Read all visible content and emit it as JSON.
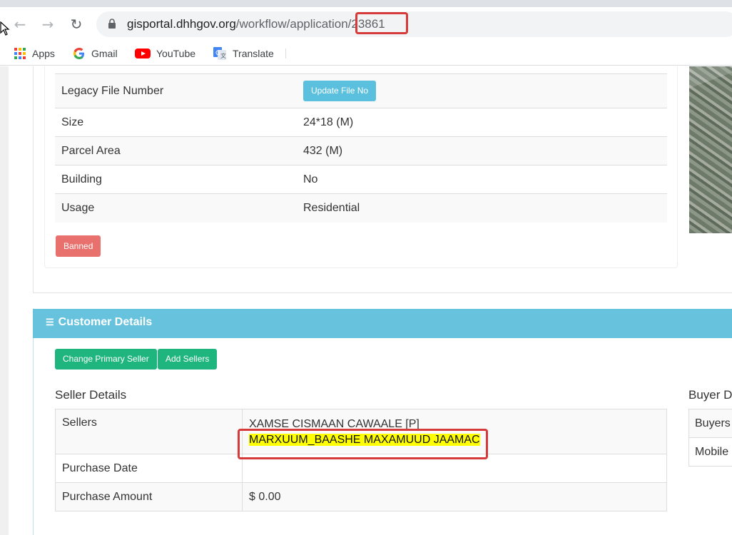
{
  "browser": {
    "url_host": "gisportal.dhhgov.org",
    "url_path": "/workflow/applicatio",
    "url_id": "n/23861",
    "bookmarks": [
      {
        "label": "Apps",
        "icon": "apps-grid-icon"
      },
      {
        "label": "Gmail",
        "icon": "google-g-icon"
      },
      {
        "label": "YouTube",
        "icon": "youtube-icon"
      },
      {
        "label": "Translate",
        "icon": "translate-icon"
      }
    ]
  },
  "property": {
    "rows": [
      {
        "label": "Legacy File Number",
        "value": ""
      },
      {
        "label": "Size",
        "value": "24*18 (M)"
      },
      {
        "label": "Parcel Area",
        "value": "432 (M)"
      },
      {
        "label": "Building",
        "value": "No"
      },
      {
        "label": "Usage",
        "value": "Residential"
      }
    ],
    "update_file_button": "Update File No",
    "banned_button": "Banned"
  },
  "customer": {
    "title": "Customer Details",
    "change_primary_seller": "Change Primary Seller",
    "add_sellers": "Add Sellers",
    "seller_details_title": "Seller Details",
    "buyer_details_title": "Buyer D",
    "seller_rows": {
      "sellers_label": "Sellers",
      "seller_1": "XAMSE CISMAAN CAWAALE [P]",
      "seller_2": "MARXUUM_BAASHE MAXAMUUD JAAMAC",
      "purchase_date_label": "Purchase Date",
      "purchase_date_value": "",
      "purchase_amount_label": "Purchase Amount",
      "purchase_amount_value": "$ 0.00"
    },
    "buyer_rows": [
      "Buyers",
      "Mobile"
    ]
  },
  "colors": {
    "header_accent": "#67c3dd",
    "info_button": "#5bc0de",
    "danger_button": "#e8716d",
    "success_button": "#1fb57f",
    "annotation_red": "#d73a3a",
    "highlight_yellow": "#ffff00"
  }
}
